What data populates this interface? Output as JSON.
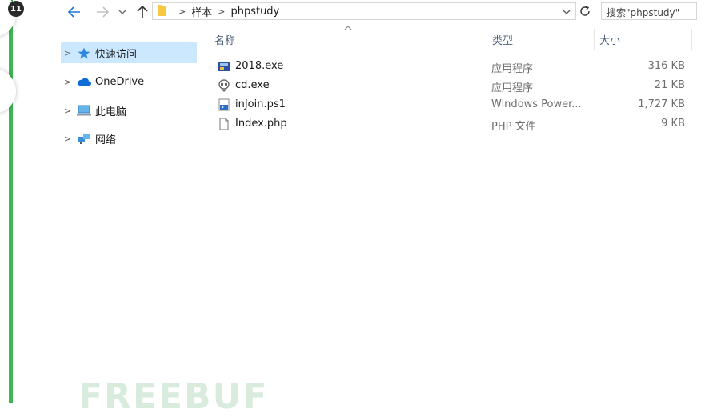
{
  "badge": "11",
  "address": {
    "crumbs": [
      "样本",
      "phpstudy"
    ],
    "search_placeholder": "搜索\"phpstudy\""
  },
  "nav_pane": [
    {
      "label": "快速访问",
      "icon": "star-icon",
      "selected": true
    },
    {
      "label": "OneDrive",
      "icon": "cloud-icon",
      "selected": false
    },
    {
      "label": "此电脑",
      "icon": "computer-icon",
      "selected": false
    },
    {
      "label": "网络",
      "icon": "network-icon",
      "selected": false
    }
  ],
  "columns": {
    "name": "名称",
    "type": "类型",
    "size": "大小"
  },
  "files": [
    {
      "name": "2018.exe",
      "type": "应用程序",
      "size": "316 KB",
      "icon": "app-exe-icon"
    },
    {
      "name": "cd.exe",
      "type": "应用程序",
      "size": "21 KB",
      "icon": "alien-exe-icon"
    },
    {
      "name": "inJoin.ps1",
      "type": "Windows Power...",
      "size": "1,727 KB",
      "icon": "powershell-script-icon"
    },
    {
      "name": "Index.php",
      "type": "PHP 文件",
      "size": "9 KB",
      "icon": "document-icon"
    }
  ],
  "watermark": "FREEBUF",
  "colors": {
    "accent": "#1e73d8",
    "selected_bg": "#cce8ff",
    "green_bar": "#3db455",
    "folder": "#f7c843"
  }
}
